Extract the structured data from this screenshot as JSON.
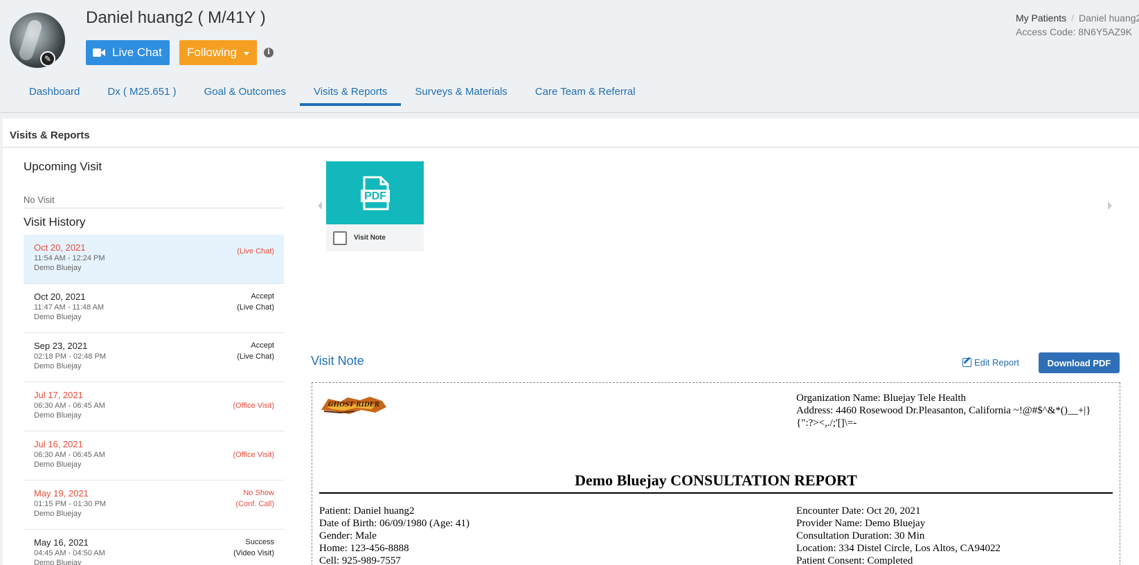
{
  "header": {
    "patient_name": "Daniel huang2 ( M/41Y )",
    "live_chat_label": "Live Chat",
    "following_label": "Following",
    "info_glyph": "i"
  },
  "breadcrumb": {
    "parent": "My Patients",
    "separator": "/",
    "current": "Daniel huang2"
  },
  "access_code": "Access Code: 8N6Y5AZ9K",
  "tabs": [
    {
      "label": "Dashboard"
    },
    {
      "label": "Dx ( M25.651 )"
    },
    {
      "label": "Goal & Outcomes"
    },
    {
      "label": "Visits & Reports"
    },
    {
      "label": "Surveys & Materials"
    },
    {
      "label": "Care Team & Referral"
    }
  ],
  "panel": {
    "title": "Visits & Reports",
    "upcoming_title": "Upcoming Visit",
    "no_visit": "No Visit",
    "history_title": "Visit History"
  },
  "visits": [
    {
      "date": "Oct 20, 2021",
      "time": "11:54 AM - 12:24 PM",
      "provider": "Demo Bluejay",
      "status1": "",
      "status2": "(Live Chat)"
    },
    {
      "date": "Oct 20, 2021",
      "time": "11:47 AM - 11:48 AM",
      "provider": "Demo Bluejay",
      "status1": "Accept",
      "status2": "(Live Chat)"
    },
    {
      "date": "Sep 23, 2021",
      "time": "02:18 PM - 02:48 PM",
      "provider": "Demo Bluejay",
      "status1": "Accept",
      "status2": "(Live Chat)"
    },
    {
      "date": "Jul 17, 2021",
      "time": "06:30 AM - 06:45 AM",
      "provider": "Demo Bluejay",
      "status1": "",
      "status2": "(Office Visit)"
    },
    {
      "date": "Jul 16, 2021",
      "time": "06:30 AM - 06:45 AM",
      "provider": "Demo Bluejay",
      "status1": "",
      "status2": "(Office Visit)"
    },
    {
      "date": "May 19, 2021",
      "time": "01:15 PM - 01:30 PM",
      "provider": "Demo Bluejay",
      "status1": "No Show",
      "status2": "(Conf. Call)"
    },
    {
      "date": "May 16, 2021",
      "time": "04:45 AM - 04:50 AM",
      "provider": "Demo Bluejay",
      "status1": "Success",
      "status2": "(Video Visit)"
    }
  ],
  "attachment": {
    "thumb_text": "PDF",
    "label": "Visit Note"
  },
  "visit_note": {
    "title": "Visit Note",
    "edit_label": "Edit Report",
    "download_label": "Download PDF"
  },
  "report": {
    "logo_text": "GHOST RIDER",
    "org_name": "Organization Name: Bluejay Tele Health",
    "address_line1": "Address: 4460 Rosewood Dr.Pleasanton, California ~!@#$^&*()__+|}",
    "address_line2": "{\":?><,./;'[]\\=-",
    "title": "Demo Bluejay CONSULTATION REPORT",
    "patient": "Patient: Daniel huang2",
    "dob": "Date of Birth: 06/09/1980 (Age: 41)",
    "gender": "Gender: Male",
    "home": "Home: 123-456-8888",
    "cell": "Cell: 925-989-7557",
    "encounter_date": "Encounter Date: Oct 20, 2021",
    "provider_name": "Provider Name: Demo Bluejay",
    "duration": "Consultation Duration: 30 Min",
    "location": "Location: 334 Distel Circle, Los Altos, CA94022",
    "consent": "Patient Consent: Completed"
  },
  "colors": {
    "primary": "#1f6fb5",
    "live_chat": "#2f8ee0",
    "following": "#f5a023",
    "alert_red": "#e74c3c",
    "teal": "#12b8bc"
  },
  "icons": [
    "video-camera-icon",
    "caret-down-icon",
    "info-icon",
    "pdf-file-icon",
    "edit-icon",
    "chevron-left-icon",
    "chevron-right-icon",
    "avatar-edit-icon"
  ]
}
